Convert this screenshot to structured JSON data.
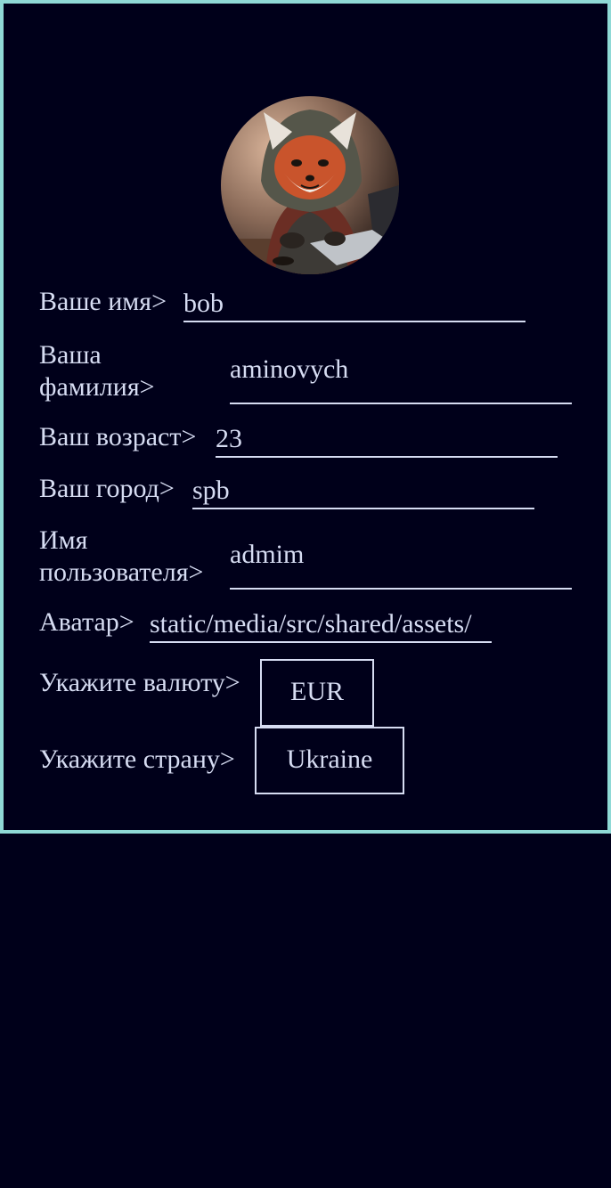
{
  "profile": {
    "avatar_alt": "avatar",
    "fields": {
      "first_name": {
        "label": "Ваше имя>",
        "value": "bob"
      },
      "last_name": {
        "label_line1": "Ваша",
        "label_line2": "фамилия>",
        "value": "aminovych"
      },
      "age": {
        "label": "Ваш возраст>",
        "value": "23"
      },
      "city": {
        "label": "Ваш город>",
        "value": "spb"
      },
      "username": {
        "label_line1": "Имя",
        "label_line2": "пользователя>",
        "value": "admim"
      },
      "avatar_path": {
        "label": "Аватар>",
        "value": "static/media/src/shared/assets/"
      }
    },
    "currency": {
      "label": "Укажите валюту>",
      "value": "EUR"
    },
    "country": {
      "label": "Укажите страну>",
      "value": "Ukraine"
    }
  },
  "colors": {
    "background": "#00001a",
    "card_border": "#8fd9d6",
    "text": "#d6dcf2"
  }
}
